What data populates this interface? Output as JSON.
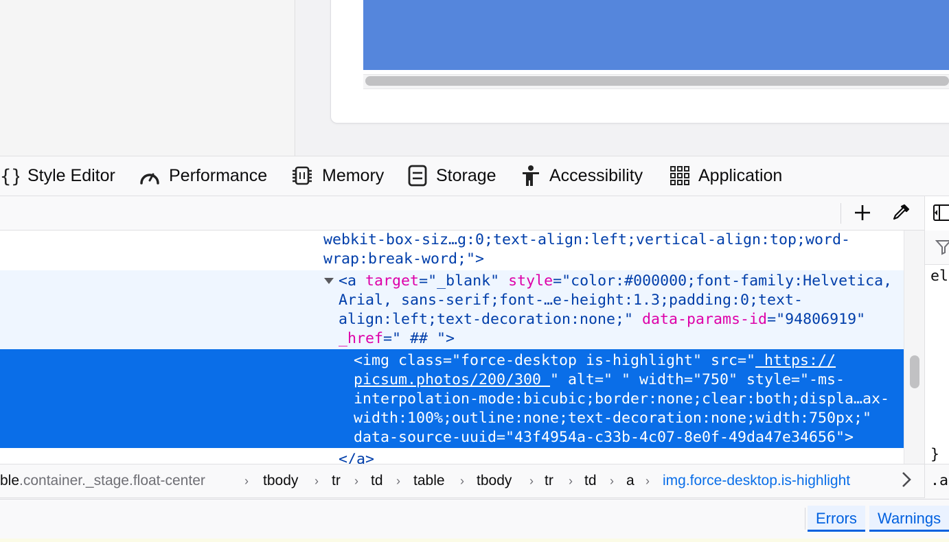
{
  "tabs": [
    {
      "label": "Style Editor",
      "icon": "style-editor-icon"
    },
    {
      "label": "Performance",
      "icon": "performance-icon"
    },
    {
      "label": "Memory",
      "icon": "memory-icon"
    },
    {
      "label": "Storage",
      "icon": "storage-icon"
    },
    {
      "label": "Accessibility",
      "icon": "accessibility-icon"
    },
    {
      "label": "Application",
      "icon": "application-icon"
    }
  ],
  "toolbar": {
    "add_node_icon": "plus-icon",
    "eyedropper_icon": "eyedropper-icon"
  },
  "markup": {
    "line1": "webkit-box-siz…g:0;text-align:left;vertical-align:top;word-",
    "line2": "wrap:break-word;\">",
    "a_open": "<",
    "a_tag": "a",
    "a_attr1": "target",
    "a_val1": "\"_blank\"",
    "a_attr2": "style",
    "a_val2a": "\"color:#000000;font-family:Helvetica,",
    "a_val2b": "Arial, sans-serif;font-…e-height:1.3;padding:0;text-",
    "a_val2c": "align:left;text-decoration:none;\"",
    "a_attr3": "data-params-id",
    "a_val3": "\"94806919\"",
    "a_attr4": "_href",
    "a_val4": "\" ## \"",
    "a_close": ">",
    "img_1a": "<img class=\"force-desktop is-highlight\" src=\"",
    "img_1b": " https://",
    "img_2a": "picsum.photos/200/300 ",
    "img_2b": "\" alt=\" \" width=\"750\" style=\"-ms-",
    "img_3": "interpolation-mode:bicubic;border:none;clear:both;displa…ax-",
    "img_4": "width:100%;outline:none;text-decoration:none;width:750px;\"",
    "img_5": "data-source-uuid=\"43f4954a-c33b-4c07-8e0f-49da47e34656\">",
    "close_a_lt": "</",
    "close_a_tag": "a",
    "close_a_gt": ">"
  },
  "breadcrumbs": {
    "first_dim": "ble",
    "first_rest": ".container._stage.float-center",
    "items": [
      "tbody",
      "tr",
      "td",
      "table",
      "tbody",
      "tr",
      "td",
      "a"
    ],
    "active": "img.force-desktop.is-highlight"
  },
  "side_panel": {
    "rule_text": "el",
    "brace": "}",
    "bottom_text": ".a"
  },
  "console": {
    "errors_label": "Errors",
    "warnings_label": "Warnings"
  },
  "colors": {
    "selection": "#0a6ee8",
    "accent": "#0060df",
    "page_blue": "#5586dc"
  }
}
